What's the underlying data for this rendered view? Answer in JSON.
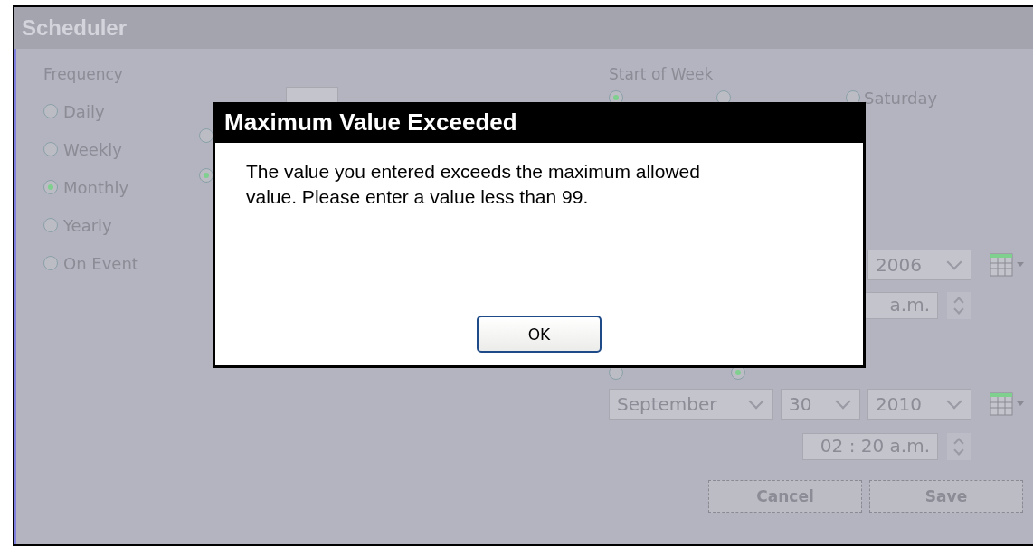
{
  "window": {
    "title": "Scheduler"
  },
  "frequency": {
    "label": "Frequency",
    "options": [
      {
        "label": "Daily",
        "selected": false
      },
      {
        "label": "Weekly",
        "selected": false
      },
      {
        "label": "Monthly",
        "selected": true
      },
      {
        "label": "Yearly",
        "selected": false
      },
      {
        "label": "On Event",
        "selected": false
      }
    ]
  },
  "monthly": {
    "options": [
      {
        "selected": false
      },
      {
        "selected": true
      }
    ]
  },
  "start_of_week": {
    "label": "Start of Week",
    "options": [
      {
        "selected": true
      },
      {
        "selected": false
      },
      {
        "label": "Saturday",
        "selected": false
      }
    ]
  },
  "start": {
    "year": "2006",
    "time": "a.m."
  },
  "end": {
    "options": [
      {
        "selected": false
      },
      {
        "selected": true
      }
    ],
    "month": "September",
    "day": "30",
    "year": "2010",
    "time": "02 : 20 a.m."
  },
  "buttons": [
    "Cancel",
    "Save"
  ],
  "dialog": {
    "title": "Maximum Value Exceeded",
    "message": "The value you entered exceeds the maximum allowed value.  Please enter a value less than 99.",
    "button": "OK"
  }
}
